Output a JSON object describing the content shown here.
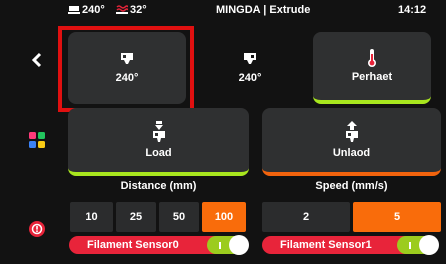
{
  "topbar": {
    "bed_temp": "240°",
    "nozzle_temp": "32°",
    "title": "MINGDA | Extrude",
    "time": "14:12"
  },
  "sidebar": {
    "back_icon": "chevron-left-icon",
    "apps_icon": "colored-grid-icon",
    "warning_icon": "warning-icon"
  },
  "extruders": [
    {
      "temp": "240°",
      "icon": "extruder-nozzle-icon"
    },
    {
      "temp": "240°",
      "icon": "extruder-nozzle-icon"
    }
  ],
  "preheat": {
    "label": "Perhaet",
    "icon": "thermometer-icon"
  },
  "load": {
    "label": "Load",
    "icon": "filament-load-icon"
  },
  "unload": {
    "label": "Unlaod",
    "icon": "filament-unload-icon"
  },
  "distance": {
    "title": "Distance (mm)",
    "options": [
      "10",
      "25",
      "50",
      "100"
    ],
    "selected": "100"
  },
  "speed": {
    "title": "Speed (mm/s)",
    "options": [
      "2",
      "5"
    ],
    "selected": "5"
  },
  "sensors": [
    {
      "label": "Filament Sensor0",
      "on": true
    },
    {
      "label": "Filament Sensor1",
      "on": true
    }
  ],
  "colors": {
    "accent_green": "#a8e61e",
    "accent_orange": "#f96c0b",
    "sensor_red": "#e8243a",
    "highlight_red": "#e01010"
  }
}
